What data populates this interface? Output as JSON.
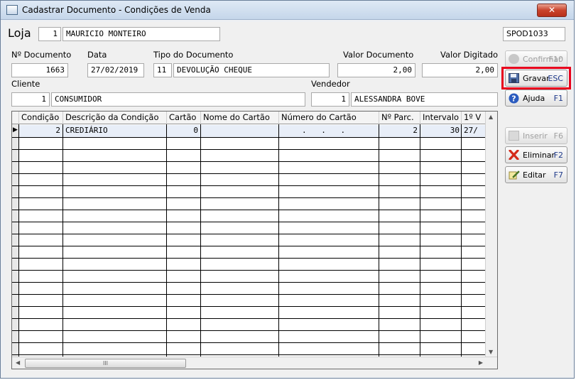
{
  "window": {
    "title": "Cadastrar Documento - Condições de Venda",
    "close_label": "✕"
  },
  "loja": {
    "label": "Loja",
    "code": "1",
    "name": "MAURICIO MONTEIRO"
  },
  "user_code": "SPOD1033",
  "documento": {
    "numero_label": "Nº Documento",
    "numero": "1663",
    "data_label": "Data",
    "data": "27/02/2019",
    "tipo_label": "Tipo do Documento",
    "tipo_code": "11",
    "tipo": "DEVOLUÇÃO CHEQUE",
    "valor_label": "Valor Documento",
    "valor": "2,00",
    "valor_digitado_label": "Valor Digitado",
    "valor_digitado": "2,00"
  },
  "cliente": {
    "label": "Cliente",
    "code": "1",
    "name": "CONSUMIDOR"
  },
  "vendedor": {
    "label": "Vendedor",
    "code": "1",
    "name": "ALESSANDRA BOVE"
  },
  "buttons": {
    "confirmar": {
      "label": "Confirmar",
      "key": "F10"
    },
    "gravar": {
      "label": "Gravar",
      "key": "ESC"
    },
    "ajuda": {
      "label": "Ajuda",
      "key": "F1"
    },
    "inserir": {
      "label": "Inserir",
      "key": "F6"
    },
    "eliminar": {
      "label": "Eliminar",
      "key": "F2"
    },
    "editar": {
      "label": "Editar",
      "key": "F7"
    }
  },
  "grid": {
    "columns": [
      "Condição",
      "Descrição da Condição",
      "Cartão",
      "Nome do Cartão",
      "Número do Cartão",
      "Nº Parc.",
      "Intervalo",
      "1º V"
    ],
    "rows": [
      {
        "condicao": "2",
        "descricao": "CREDIÁRIO",
        "cartao": "0",
        "nome_cartao": "",
        "numero_cartao": ". . .",
        "parcelas": "2",
        "intervalo": "30",
        "primeiro_venc": "27/"
      }
    ],
    "hscroll_grip": "III"
  },
  "colors": {
    "highlight": "#e8001c",
    "key_text": "#1f3a8a"
  }
}
